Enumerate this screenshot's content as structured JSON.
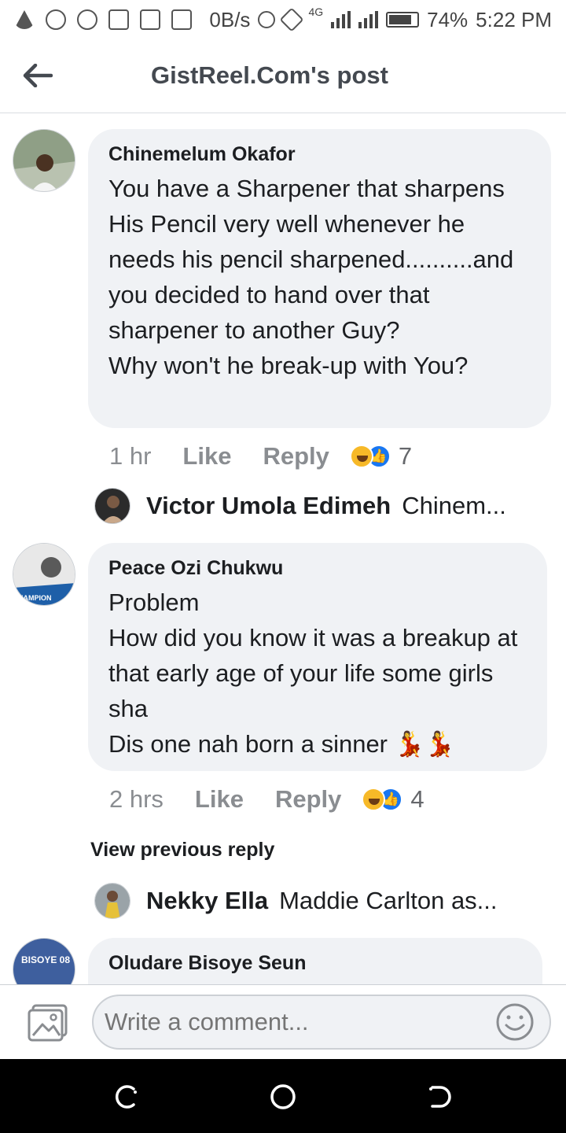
{
  "status_bar": {
    "network_speed": "0B/s",
    "network_type": "4G",
    "battery": "74%",
    "battery_level": 0.74,
    "time": "5:22 PM"
  },
  "header": {
    "title": "GistReel.Com's post",
    "back_icon": "arrow-left-icon"
  },
  "comments": [
    {
      "author": "Chinemelum Okafor",
      "text": "You have a Sharpener that sharpens His Pencil very well whenever he needs his pencil sharpened..........and you decided to hand over that sharpener to another Guy?\nWhy won't he break-up with You?",
      "time": "1 hr",
      "like_label": "Like",
      "reply_label": "Reply",
      "reaction_count": "7",
      "reply_preview": {
        "name": "Victor Umola Edimeh",
        "snippet": "Chinem..."
      }
    },
    {
      "author": "Peace Ozi Chukwu",
      "text": "Problem\nHow did you know it was a breakup at that early age of your life some girls sha\nDis one nah born a sinner 💃💃",
      "time": "2 hrs",
      "like_label": "Like",
      "reply_label": "Reply",
      "reaction_count": "4",
      "view_previous": "View previous reply",
      "reply_preview": {
        "name": "Nekky Ella",
        "snippet": "Maddie Carlton as..."
      }
    },
    {
      "author": "Oludare Bisoye Seun",
      "avatar_text": "BISOYE 08"
    }
  ],
  "avatar_badge_text": "HAMPION",
  "composer": {
    "placeholder": "Write a comment...",
    "photo_icon": "photo-icon",
    "emoji_icon": "smiley-icon"
  },
  "nav": {
    "recent": "recent-apps-icon",
    "home": "home-icon",
    "back": "back-icon"
  }
}
